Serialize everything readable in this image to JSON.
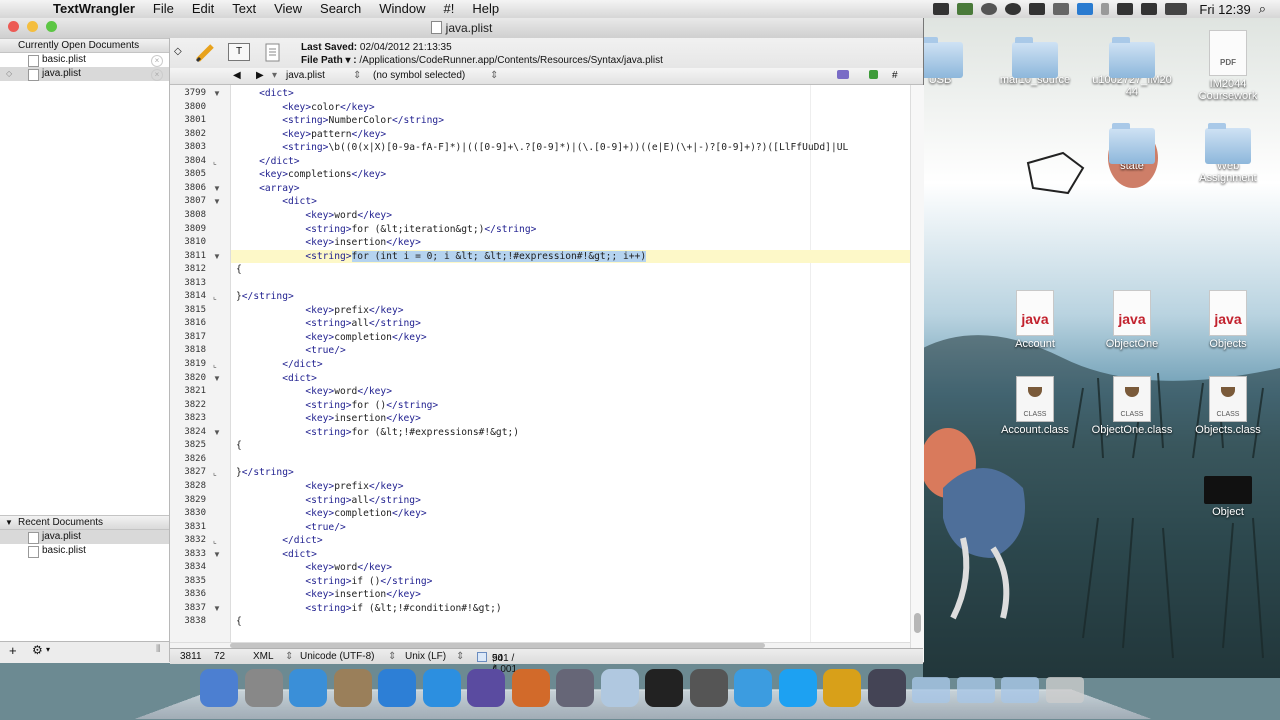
{
  "menubar": {
    "app": "TextWrangler",
    "items": [
      "File",
      "Edit",
      "Text",
      "View",
      "Search",
      "Window",
      "#!",
      "Help"
    ],
    "clock": "Fri 12:39"
  },
  "window": {
    "title": "java.plist",
    "sidebar": {
      "open_header": "Currently Open Documents",
      "open_docs": [
        "basic.plist",
        "java.plist"
      ],
      "recent_header": "Recent Documents",
      "recent_docs": [
        "java.plist",
        "basic.plist"
      ],
      "add": "+",
      "gear": "⚙"
    },
    "toolbar": {
      "saved_label": "Last Saved:",
      "saved_value": "02/04/2012 21:13:35",
      "path_label": "File Path ▾ :",
      "path_value": "/Applications/CodeRunner.app/Contents/Resources/Syntax/java.plist"
    },
    "navbar": {
      "file": "java.plist",
      "symbol": "(no symbol selected)"
    },
    "status": {
      "line": "3811",
      "col": "72",
      "language": "XML",
      "encoding": "Unicode (UTF-8)",
      "line_endings": "Unix (LF)",
      "counts": "50 / 10 / 0",
      "size": "941 / 4,001"
    }
  },
  "code": {
    "numbers": [
      "3799",
      "3800",
      "3801",
      "3802",
      "3803",
      "3804",
      "3805",
      "3806",
      "3807",
      "3808",
      "3809",
      "3810",
      "3811",
      "3812",
      "3813",
      "3814",
      "3815",
      "3816",
      "3817",
      "3818",
      "3819",
      "3820",
      "3821",
      "3822",
      "3823",
      "3824",
      "3825",
      "3826",
      "3827",
      "3828",
      "3829",
      "3830",
      "3831",
      "3832",
      "3833",
      "3834",
      "3835",
      "3836",
      "3837",
      "3838"
    ],
    "lines": [
      "    <dict>",
      "        <key>color</key>",
      "        <string>NumberColor</string>",
      "        <key>pattern</key>",
      "        <string>\\b((0(x|X)[0-9a-fA-F]*)|(([0-9]+\\.?[0-9]*)|(\\.[0-9]+))((e|E)(\\+|-)?[0-9]+)?)([LlFfUuDd]|UL",
      "    </dict>",
      "    <key>completions</key>",
      "    <array>",
      "        <dict>",
      "            <key>word</key>",
      "            <string>for (&lt;iteration&gt;)</string>",
      "            <key>insertion</key>",
      "            <string>",
      "{",
      "",
      "}</string>",
      "            <key>prefix</key>",
      "            <string>all</string>",
      "            <key>completion</key>",
      "            <true/>",
      "        </dict>",
      "        <dict>",
      "            <key>word</key>",
      "            <string>for ()</string>",
      "            <key>insertion</key>",
      "            <string>for (&lt;!#expressions#!&gt;)",
      "{",
      "",
      "}</string>",
      "            <key>prefix</key>",
      "            <string>all</string>",
      "            <key>completion</key>",
      "            <true/>",
      "        </dict>",
      "        <dict>",
      "            <key>word</key>",
      "            <string>if ()</string>",
      "            <key>insertion</key>",
      "            <string>if (&lt;!#condition#!&gt;)",
      "{"
    ],
    "selected_text": "for (int i = 0; i &lt; &lt;!#expression#!&gt;; i++)",
    "fold_markers": [
      "▼",
      "",
      "",
      "",
      "",
      "⌞",
      "",
      "▼",
      "▼",
      "",
      "",
      "",
      "▼",
      "",
      "",
      "⌞",
      "",
      "",
      "",
      "",
      "⌞",
      "▼",
      "",
      "",
      "",
      "▼",
      "",
      "",
      "⌞",
      "",
      "",
      "",
      "",
      "⌞",
      "▼",
      "",
      "",
      "",
      "▼",
      ""
    ]
  },
  "desktop": {
    "icons": [
      {
        "label": "USB",
        "type": "folder"
      },
      {
        "label": "mar10_source",
        "type": "folder"
      },
      {
        "label": "u1002727_IM2044",
        "type": "folder"
      },
      {
        "label": "IM2044 Coursework",
        "type": "pdf",
        "badge": "PDF"
      },
      {
        "label": "state",
        "type": "folder"
      },
      {
        "label": "Web Assignment",
        "type": "folder"
      },
      {
        "label": "Account",
        "type": "java",
        "badge": "java"
      },
      {
        "label": "ObjectOne",
        "type": "java",
        "badge": "java"
      },
      {
        "label": "Objects",
        "type": "java",
        "badge": "java"
      },
      {
        "label": "Account.class",
        "type": "class",
        "badge": "CLASS"
      },
      {
        "label": "ObjectOne.class",
        "type": "class",
        "badge": "CLASS"
      },
      {
        "label": "Objects.class",
        "type": "class",
        "badge": "CLASS"
      },
      {
        "label": "Object",
        "type": "black"
      }
    ]
  },
  "dock": {
    "apps": [
      "finder",
      "launchpad",
      "safari",
      "preview",
      "itunes",
      "app-store",
      "instruments",
      "presentation",
      "screenshot",
      "preview-doc",
      "p-app",
      "steam",
      "messages",
      "twitter",
      "flow",
      "photo-booth",
      "folder",
      "downloads",
      "documents",
      "trash"
    ]
  },
  "colors": {
    "selection": "#b5d3ef",
    "current_line": "#fdf8c8",
    "tag": "#1f1f8f",
    "close": "#ec5b55",
    "minimize": "#f4be3f",
    "zoom": "#5cc644"
  }
}
